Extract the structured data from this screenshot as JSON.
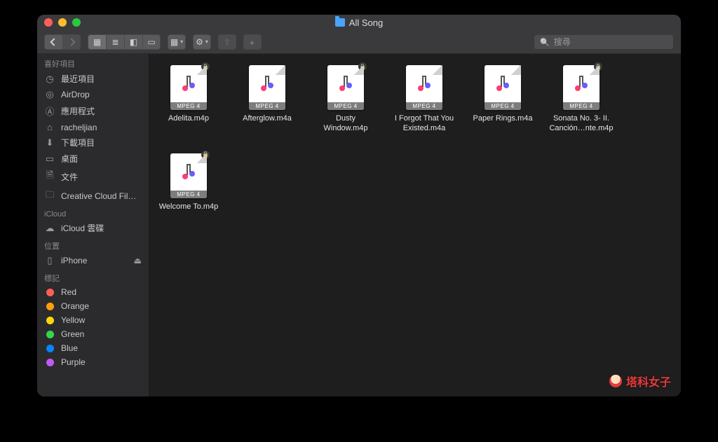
{
  "window": {
    "title": "All Song"
  },
  "toolbar": {
    "search_placeholder": "搜尋"
  },
  "sidebar": {
    "sections": [
      {
        "label": "喜好項目",
        "items": [
          {
            "icon": "clock",
            "label": "最近項目"
          },
          {
            "icon": "airdrop",
            "label": "AirDrop"
          },
          {
            "icon": "apps",
            "label": "應用程式"
          },
          {
            "icon": "home",
            "label": "racheljian"
          },
          {
            "icon": "download",
            "label": "下載項目"
          },
          {
            "icon": "desktop",
            "label": "桌面"
          },
          {
            "icon": "doc",
            "label": "文件"
          },
          {
            "icon": "folder",
            "label": "Creative Cloud Fil…"
          }
        ]
      },
      {
        "label": "iCloud",
        "items": [
          {
            "icon": "cloud",
            "label": "iCloud 雲碟"
          }
        ]
      },
      {
        "label": "位置",
        "items": [
          {
            "icon": "phone",
            "label": "iPhone",
            "eject": true
          }
        ]
      },
      {
        "label": "標記",
        "tags": [
          {
            "color": "#ff5f57",
            "label": "Red"
          },
          {
            "color": "#ff9f0a",
            "label": "Orange"
          },
          {
            "color": "#ffd60a",
            "label": "Yellow"
          },
          {
            "color": "#32d74b",
            "label": "Green"
          },
          {
            "color": "#0a84ff",
            "label": "Blue"
          },
          {
            "color": "#bf5af2",
            "label": "Purple"
          }
        ]
      }
    ]
  },
  "files": {
    "badge": "MPEG 4",
    "items": [
      {
        "name": "Adelita.m4p",
        "locked": true
      },
      {
        "name": "Afterglow.m4a",
        "locked": false
      },
      {
        "name": "Dusty Window.m4p",
        "locked": true
      },
      {
        "name": "I Forgot That You Existed.m4a",
        "locked": false
      },
      {
        "name": "Paper Rings.m4a",
        "locked": false
      },
      {
        "name": "Sonata No. 3- II. Canción…nte.m4p",
        "locked": true
      },
      {
        "name": "Welcome To.m4p",
        "locked": true
      }
    ]
  },
  "watermark": "塔科女子"
}
